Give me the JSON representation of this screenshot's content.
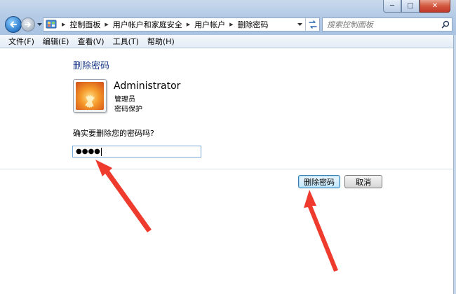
{
  "window": {
    "minimize_glyph": "─",
    "maximize_glyph": "□",
    "close_glyph": "✕"
  },
  "address_bar": {
    "breadcrumbs": [
      {
        "label": "控制面板"
      },
      {
        "label": "用户帐户和家庭安全"
      },
      {
        "label": "用户帐户"
      },
      {
        "label": "删除密码"
      }
    ]
  },
  "search": {
    "placeholder": "搜索控制面板"
  },
  "menu": {
    "items": [
      {
        "label": "文件(F)"
      },
      {
        "label": "编辑(E)"
      },
      {
        "label": "查看(V)"
      },
      {
        "label": "工具(T)"
      },
      {
        "label": "帮助(H)"
      }
    ]
  },
  "page": {
    "title": "删除密码",
    "user": {
      "name": "Administrator",
      "role": "管理员",
      "protection": "密码保护"
    },
    "question": "确实要删除您的密码吗?",
    "password_masked": "●●●●"
  },
  "buttons": {
    "delete": "删除密码",
    "cancel": "取消"
  },
  "colors": {
    "title_blue": "#1c3a8a",
    "arrow_red": "#ee3b2e"
  },
  "icons": {
    "back": "back-arrow-icon",
    "forward": "forward-arrow-icon",
    "control_panel": "control-panel-icon",
    "refresh": "refresh-icon",
    "search": "search-icon"
  }
}
